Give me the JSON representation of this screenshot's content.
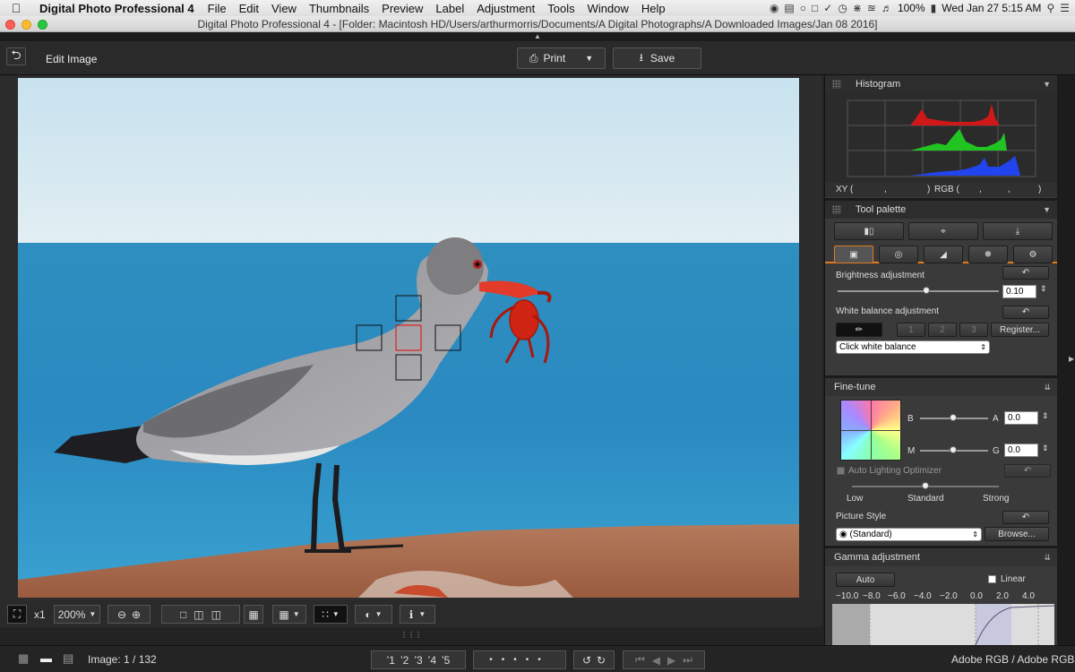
{
  "menubar": {
    "app_name": "Digital Photo Professional 4",
    "items": [
      "File",
      "Edit",
      "View",
      "Thumbnails",
      "Preview",
      "Label",
      "Adjustment",
      "Tools",
      "Window",
      "Help"
    ],
    "battery": "100%",
    "clock": "Wed Jan 27  5:15 AM"
  },
  "window": {
    "title": "Digital Photo Professional 4 - [Folder: Macintosh HD/Users/arthurmorris/Documents/A Digital Photographs/A Downloaded Images/Jan 08 2016]"
  },
  "toolbar": {
    "mode_label": "Edit Image",
    "print_label": "Print",
    "save_label": "Save"
  },
  "histogram": {
    "title": "Histogram",
    "xy_label": "XY (",
    "xy_comma1": ",",
    "xy_close": ")",
    "rgb_label": "RGB (",
    "rgb_comma1": ",",
    "rgb_comma2": ",",
    "rgb_close": ")"
  },
  "tool_palette": {
    "title": "Tool palette",
    "brightness_label": "Brightness adjustment",
    "brightness_value": "0.10",
    "brightness_level": 0.55,
    "wb_label": "White balance adjustment",
    "wb_buttons": [
      "1",
      "2",
      "3"
    ],
    "register_label": "Register...",
    "wb_select": "Click white balance"
  },
  "fine_tune": {
    "title": "Fine-tune",
    "b_label": "B",
    "a_label": "A",
    "a_value": "0.0",
    "m_label": "M",
    "g_label": "G",
    "g_value": "0.0",
    "alo_label": "Auto Lighting Optimizer",
    "alo_levels": [
      "Low",
      "Standard",
      "Strong"
    ],
    "picture_style_label": "Picture Style",
    "picture_style_value": "(Standard)",
    "browse_label": "Browse..."
  },
  "gamma": {
    "title": "Gamma adjustment",
    "auto_label": "Auto",
    "linear_label": "Linear",
    "scale": [
      "−10.0",
      "−8.0",
      "−6.0",
      "−4.0",
      "−2.0",
      "0.0",
      "2.0",
      "4.0"
    ]
  },
  "viewbar": {
    "zoom_x1": "x1",
    "zoom_value": "200%"
  },
  "statusbar": {
    "image_counter": "Image: 1 / 132",
    "ratings": [
      "ʼ1",
      "ʼ2",
      "ʼ3",
      "ʼ4",
      "ʼ5"
    ],
    "color_space": "Adobe RGB / Adobe RGB"
  },
  "colors": {
    "accent_orange": "#e07a1f",
    "hist_red": "#d11818",
    "hist_green": "#22c422",
    "hist_blue": "#2244ee"
  }
}
